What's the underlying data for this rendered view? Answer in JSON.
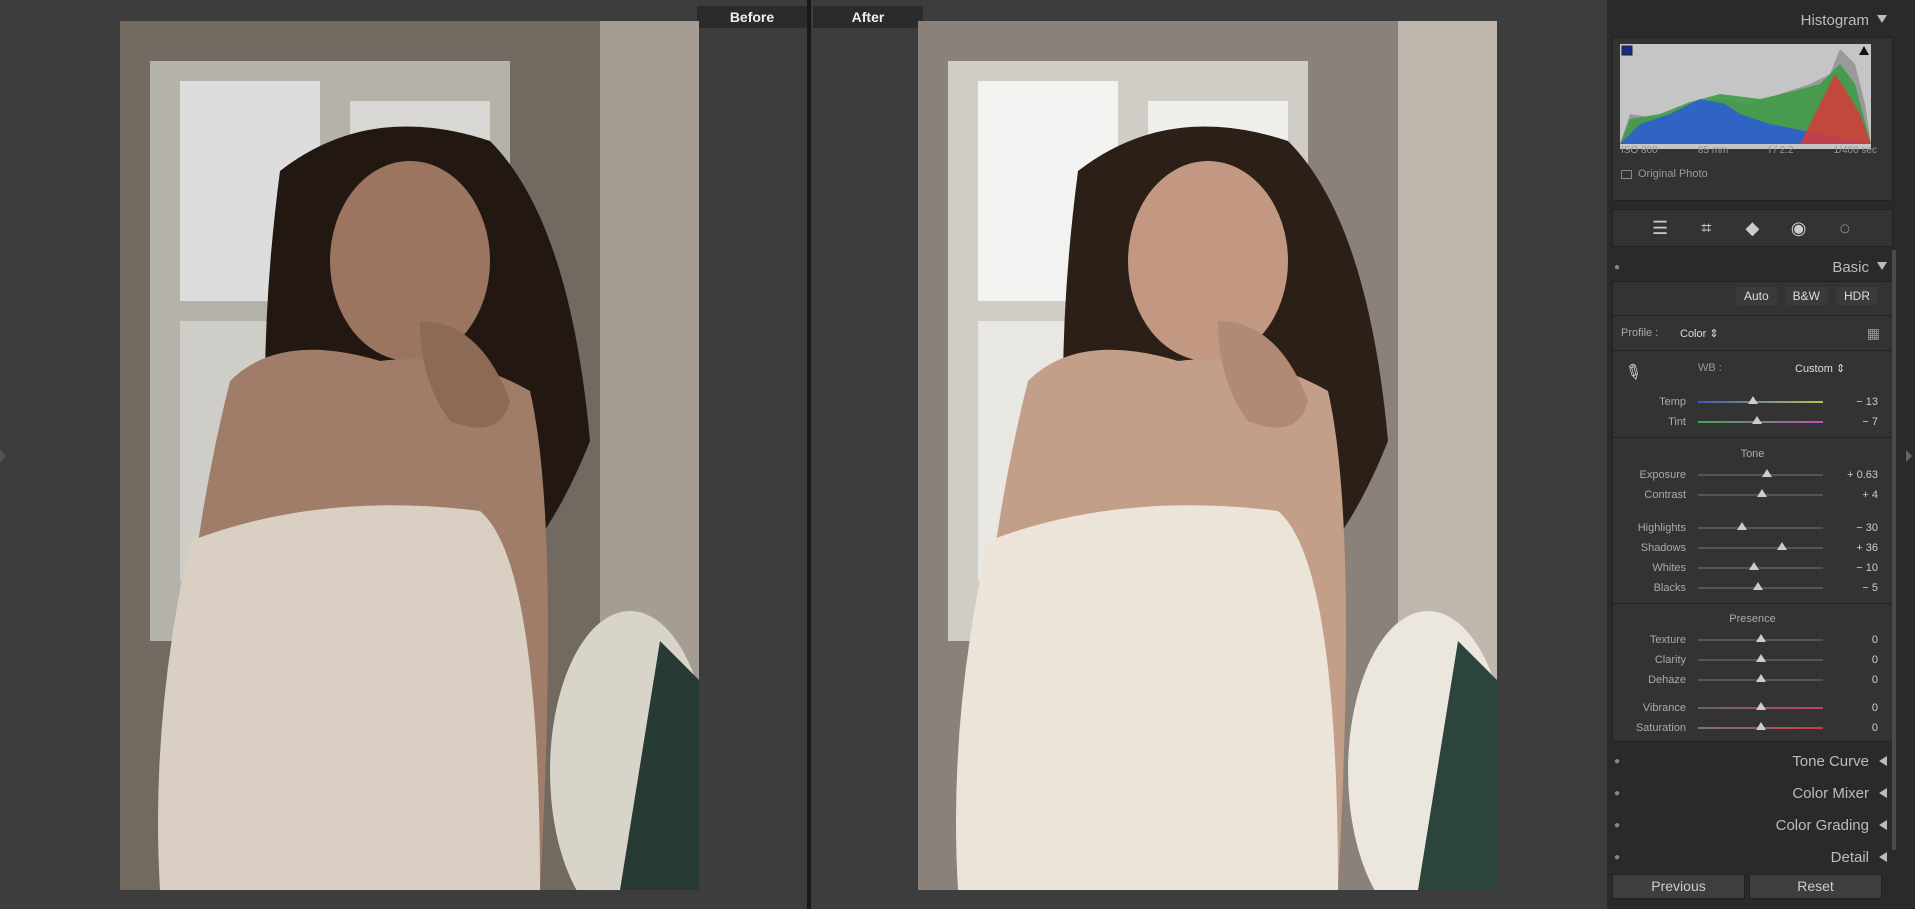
{
  "viewer": {
    "before_label": "Before",
    "after_label": "After"
  },
  "panel": {
    "histogram": {
      "title": "Histogram",
      "iso": "ISO 800",
      "focal": "85 mm",
      "aperture": "f / 2.2",
      "shutter": "1/400 sec",
      "original_photo": "Original Photo"
    },
    "basic": {
      "title": "Basic",
      "auto": "Auto",
      "bw": "B&W",
      "hdr": "HDR",
      "profile_label": "Profile :",
      "profile_value": "Color",
      "wb_label": "WB :",
      "wb_value": "Custom",
      "temp": {
        "label": "Temp",
        "value": "− 13",
        "pos": 0.44
      },
      "tint": {
        "label": "Tint",
        "value": "− 7",
        "pos": 0.47
      },
      "tone": "Tone",
      "exposure": {
        "label": "Exposure",
        "value": "+ 0.63",
        "pos": 0.55
      },
      "contrast": {
        "label": "Contrast",
        "value": "+ 4",
        "pos": 0.51
      },
      "highlights": {
        "label": "Highlights",
        "value": "− 30",
        "pos": 0.35
      },
      "shadows": {
        "label": "Shadows",
        "value": "+ 36",
        "pos": 0.67
      },
      "whites": {
        "label": "Whites",
        "value": "− 10",
        "pos": 0.45
      },
      "blacks": {
        "label": "Blacks",
        "value": "− 5",
        "pos": 0.48
      },
      "presence": "Presence",
      "texture": {
        "label": "Texture",
        "value": "0",
        "pos": 0.5
      },
      "clarity": {
        "label": "Clarity",
        "value": "0",
        "pos": 0.5
      },
      "dehaze": {
        "label": "Dehaze",
        "value": "0",
        "pos": 0.5
      },
      "vibrance": {
        "label": "Vibrance",
        "value": "0",
        "pos": 0.5
      },
      "saturation": {
        "label": "Saturation",
        "value": "0",
        "pos": 0.5
      }
    },
    "sections": {
      "tone_curve": "Tone Curve",
      "color_mixer": "Color Mixer",
      "color_grading": "Color Grading",
      "detail": "Detail"
    },
    "footer": {
      "previous": "Previous",
      "reset": "Reset"
    }
  }
}
